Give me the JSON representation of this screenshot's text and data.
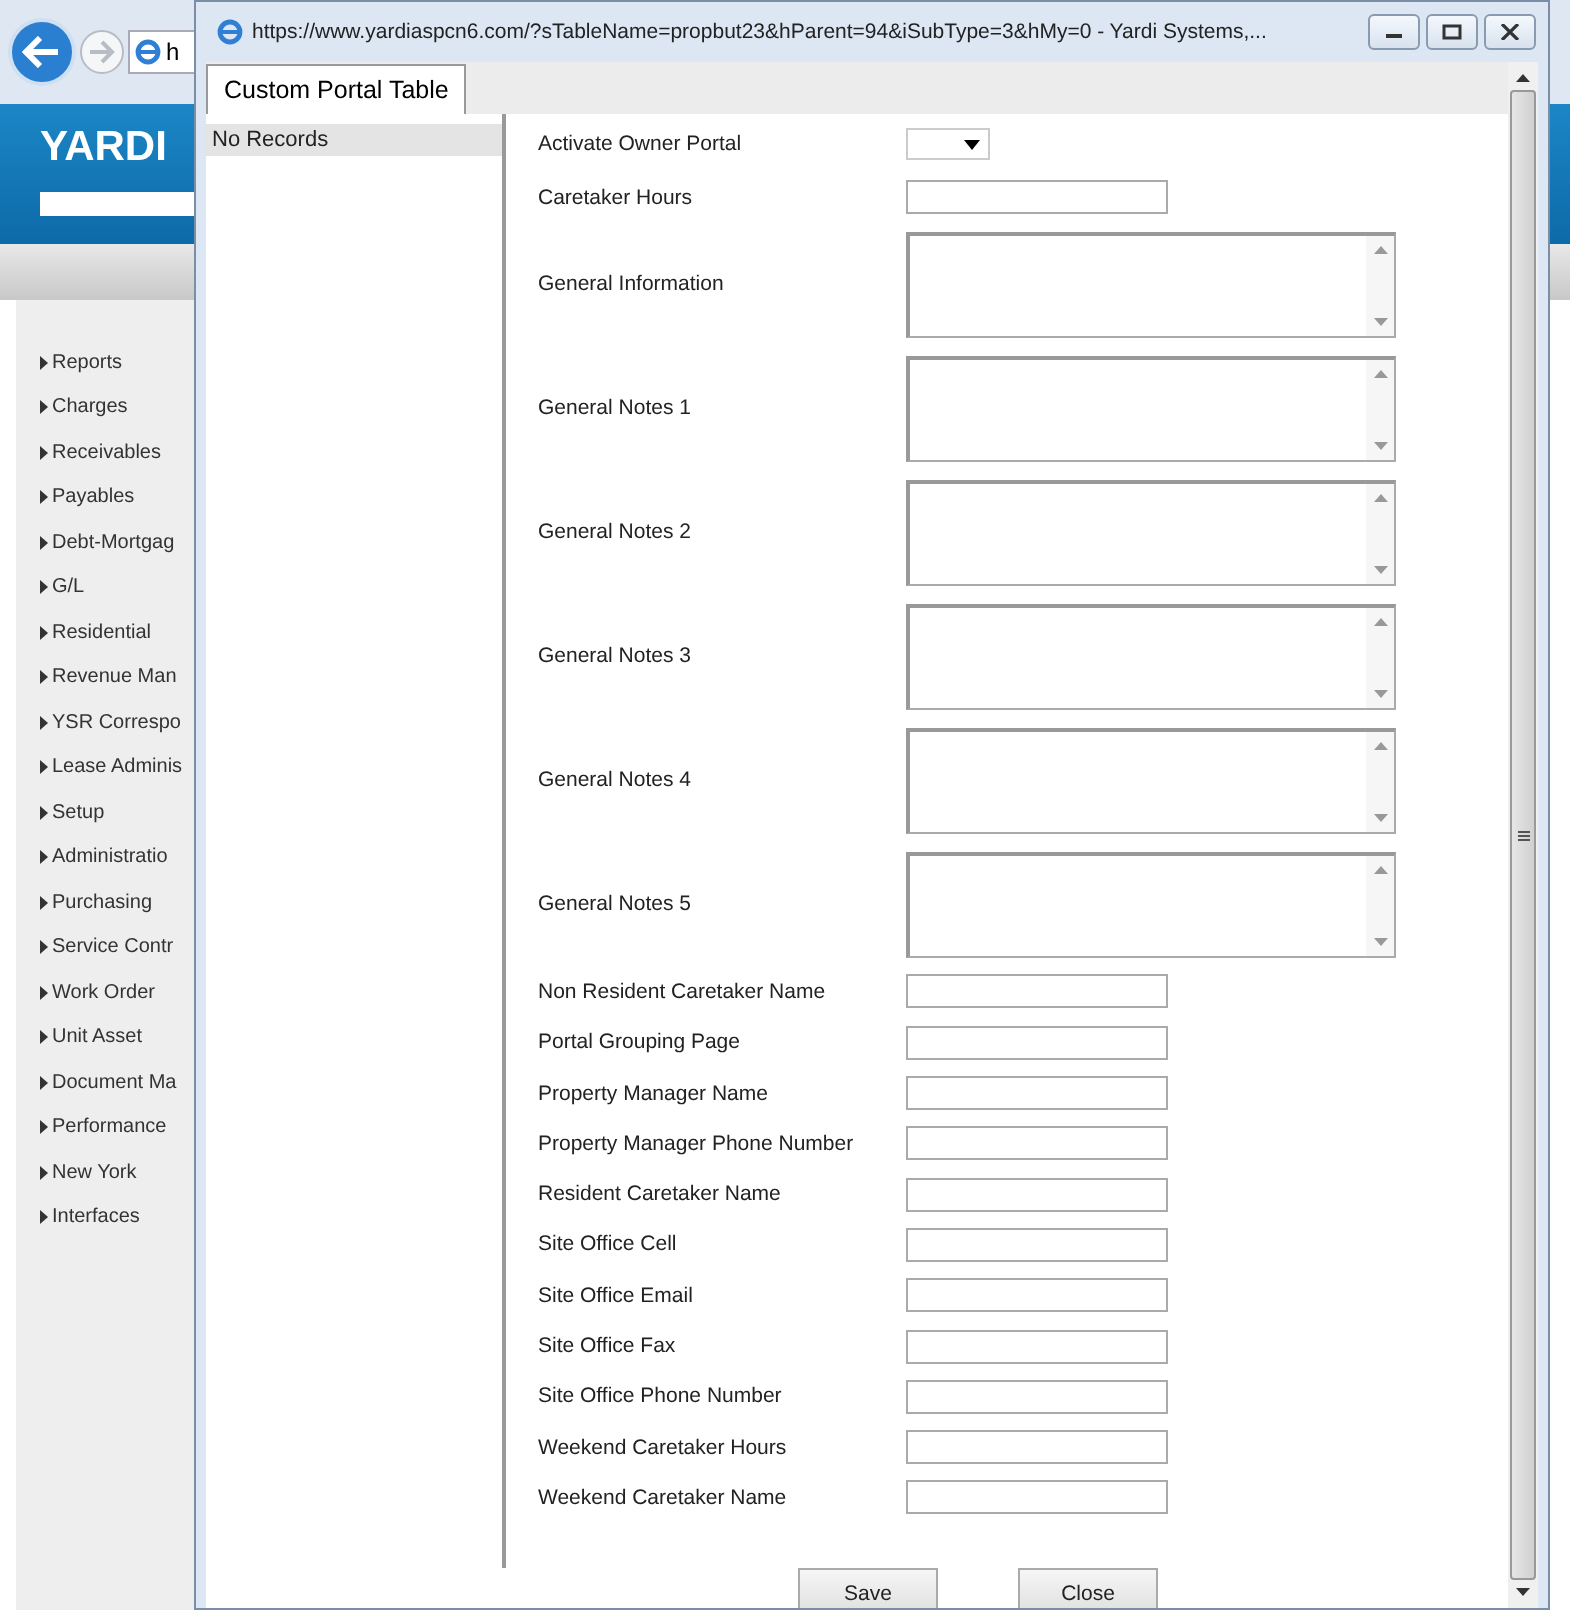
{
  "browser": {
    "address_partial": "h",
    "logo": "YARDI",
    "nav": [
      "Reports",
      "Charges",
      "Receivables",
      "Payables",
      "Debt-Mortgag",
      "G/L",
      "Residential",
      "Revenue Man",
      "YSR Correspo",
      "Lease Adminis",
      "Setup",
      "Administratio",
      "Purchasing",
      "Service Contr",
      "Work Order",
      "Unit Asset",
      "Document Ma",
      "Performance",
      "New York",
      "Interfaces"
    ]
  },
  "popup": {
    "title": "https://www.yardiaspcn6.com/?sTableName=propbut23&hParent=94&iSubType=3&hMy=0 - Yardi Systems,...",
    "tab": {
      "label": "Custom Portal Table",
      "selected": true
    },
    "records": [
      {
        "label": "No Records",
        "selected": true
      }
    ],
    "fields": [
      {
        "label": "Activate Owner Portal",
        "kind": "select"
      },
      {
        "label": "Caretaker Hours",
        "kind": "text"
      },
      {
        "label": "General Information",
        "kind": "textarea"
      },
      {
        "label": "General Notes 1",
        "kind": "textarea"
      },
      {
        "label": "General Notes 2",
        "kind": "textarea"
      },
      {
        "label": "General Notes 3",
        "kind": "textarea"
      },
      {
        "label": "General Notes 4",
        "kind": "textarea"
      },
      {
        "label": "General Notes 5",
        "kind": "textarea"
      },
      {
        "label": "Non Resident Caretaker Name",
        "kind": "text"
      },
      {
        "label": "Portal Grouping Page",
        "kind": "text"
      },
      {
        "label": "Property Manager Name",
        "kind": "text"
      },
      {
        "label": "Property Manager Phone Number",
        "kind": "text"
      },
      {
        "label": "Resident Caretaker Name",
        "kind": "text"
      },
      {
        "label": "Site Office Cell",
        "kind": "text"
      },
      {
        "label": "Site Office Email",
        "kind": "text"
      },
      {
        "label": "Site Office Fax",
        "kind": "text"
      },
      {
        "label": "Site Office Phone Number",
        "kind": "text"
      },
      {
        "label": "Weekend Caretaker Hours",
        "kind": "text"
      },
      {
        "label": "Weekend Caretaker Name",
        "kind": "text"
      }
    ],
    "buttons": [
      "Save",
      "Close"
    ]
  }
}
